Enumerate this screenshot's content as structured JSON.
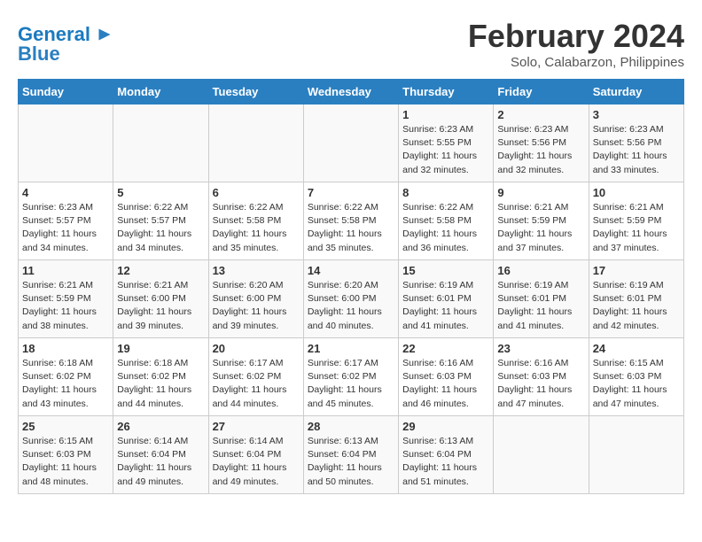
{
  "logo": {
    "line1": "General",
    "line2": "Blue"
  },
  "title": "February 2024",
  "subtitle": "Solo, Calabarzon, Philippines",
  "weekdays": [
    "Sunday",
    "Monday",
    "Tuesday",
    "Wednesday",
    "Thursday",
    "Friday",
    "Saturday"
  ],
  "weeks": [
    [
      {
        "day": "",
        "info": ""
      },
      {
        "day": "",
        "info": ""
      },
      {
        "day": "",
        "info": ""
      },
      {
        "day": "",
        "info": ""
      },
      {
        "day": "1",
        "info": "Sunrise: 6:23 AM\nSunset: 5:55 PM\nDaylight: 11 hours and 32 minutes."
      },
      {
        "day": "2",
        "info": "Sunrise: 6:23 AM\nSunset: 5:56 PM\nDaylight: 11 hours and 32 minutes."
      },
      {
        "day": "3",
        "info": "Sunrise: 6:23 AM\nSunset: 5:56 PM\nDaylight: 11 hours and 33 minutes."
      }
    ],
    [
      {
        "day": "4",
        "info": "Sunrise: 6:23 AM\nSunset: 5:57 PM\nDaylight: 11 hours and 34 minutes."
      },
      {
        "day": "5",
        "info": "Sunrise: 6:22 AM\nSunset: 5:57 PM\nDaylight: 11 hours and 34 minutes."
      },
      {
        "day": "6",
        "info": "Sunrise: 6:22 AM\nSunset: 5:58 PM\nDaylight: 11 hours and 35 minutes."
      },
      {
        "day": "7",
        "info": "Sunrise: 6:22 AM\nSunset: 5:58 PM\nDaylight: 11 hours and 35 minutes."
      },
      {
        "day": "8",
        "info": "Sunrise: 6:22 AM\nSunset: 5:58 PM\nDaylight: 11 hours and 36 minutes."
      },
      {
        "day": "9",
        "info": "Sunrise: 6:21 AM\nSunset: 5:59 PM\nDaylight: 11 hours and 37 minutes."
      },
      {
        "day": "10",
        "info": "Sunrise: 6:21 AM\nSunset: 5:59 PM\nDaylight: 11 hours and 37 minutes."
      }
    ],
    [
      {
        "day": "11",
        "info": "Sunrise: 6:21 AM\nSunset: 5:59 PM\nDaylight: 11 hours and 38 minutes."
      },
      {
        "day": "12",
        "info": "Sunrise: 6:21 AM\nSunset: 6:00 PM\nDaylight: 11 hours and 39 minutes."
      },
      {
        "day": "13",
        "info": "Sunrise: 6:20 AM\nSunset: 6:00 PM\nDaylight: 11 hours and 39 minutes."
      },
      {
        "day": "14",
        "info": "Sunrise: 6:20 AM\nSunset: 6:00 PM\nDaylight: 11 hours and 40 minutes."
      },
      {
        "day": "15",
        "info": "Sunrise: 6:19 AM\nSunset: 6:01 PM\nDaylight: 11 hours and 41 minutes."
      },
      {
        "day": "16",
        "info": "Sunrise: 6:19 AM\nSunset: 6:01 PM\nDaylight: 11 hours and 41 minutes."
      },
      {
        "day": "17",
        "info": "Sunrise: 6:19 AM\nSunset: 6:01 PM\nDaylight: 11 hours and 42 minutes."
      }
    ],
    [
      {
        "day": "18",
        "info": "Sunrise: 6:18 AM\nSunset: 6:02 PM\nDaylight: 11 hours and 43 minutes."
      },
      {
        "day": "19",
        "info": "Sunrise: 6:18 AM\nSunset: 6:02 PM\nDaylight: 11 hours and 44 minutes."
      },
      {
        "day": "20",
        "info": "Sunrise: 6:17 AM\nSunset: 6:02 PM\nDaylight: 11 hours and 44 minutes."
      },
      {
        "day": "21",
        "info": "Sunrise: 6:17 AM\nSunset: 6:02 PM\nDaylight: 11 hours and 45 minutes."
      },
      {
        "day": "22",
        "info": "Sunrise: 6:16 AM\nSunset: 6:03 PM\nDaylight: 11 hours and 46 minutes."
      },
      {
        "day": "23",
        "info": "Sunrise: 6:16 AM\nSunset: 6:03 PM\nDaylight: 11 hours and 47 minutes."
      },
      {
        "day": "24",
        "info": "Sunrise: 6:15 AM\nSunset: 6:03 PM\nDaylight: 11 hours and 47 minutes."
      }
    ],
    [
      {
        "day": "25",
        "info": "Sunrise: 6:15 AM\nSunset: 6:03 PM\nDaylight: 11 hours and 48 minutes."
      },
      {
        "day": "26",
        "info": "Sunrise: 6:14 AM\nSunset: 6:04 PM\nDaylight: 11 hours and 49 minutes."
      },
      {
        "day": "27",
        "info": "Sunrise: 6:14 AM\nSunset: 6:04 PM\nDaylight: 11 hours and 49 minutes."
      },
      {
        "day": "28",
        "info": "Sunrise: 6:13 AM\nSunset: 6:04 PM\nDaylight: 11 hours and 50 minutes."
      },
      {
        "day": "29",
        "info": "Sunrise: 6:13 AM\nSunset: 6:04 PM\nDaylight: 11 hours and 51 minutes."
      },
      {
        "day": "",
        "info": ""
      },
      {
        "day": "",
        "info": ""
      }
    ]
  ]
}
